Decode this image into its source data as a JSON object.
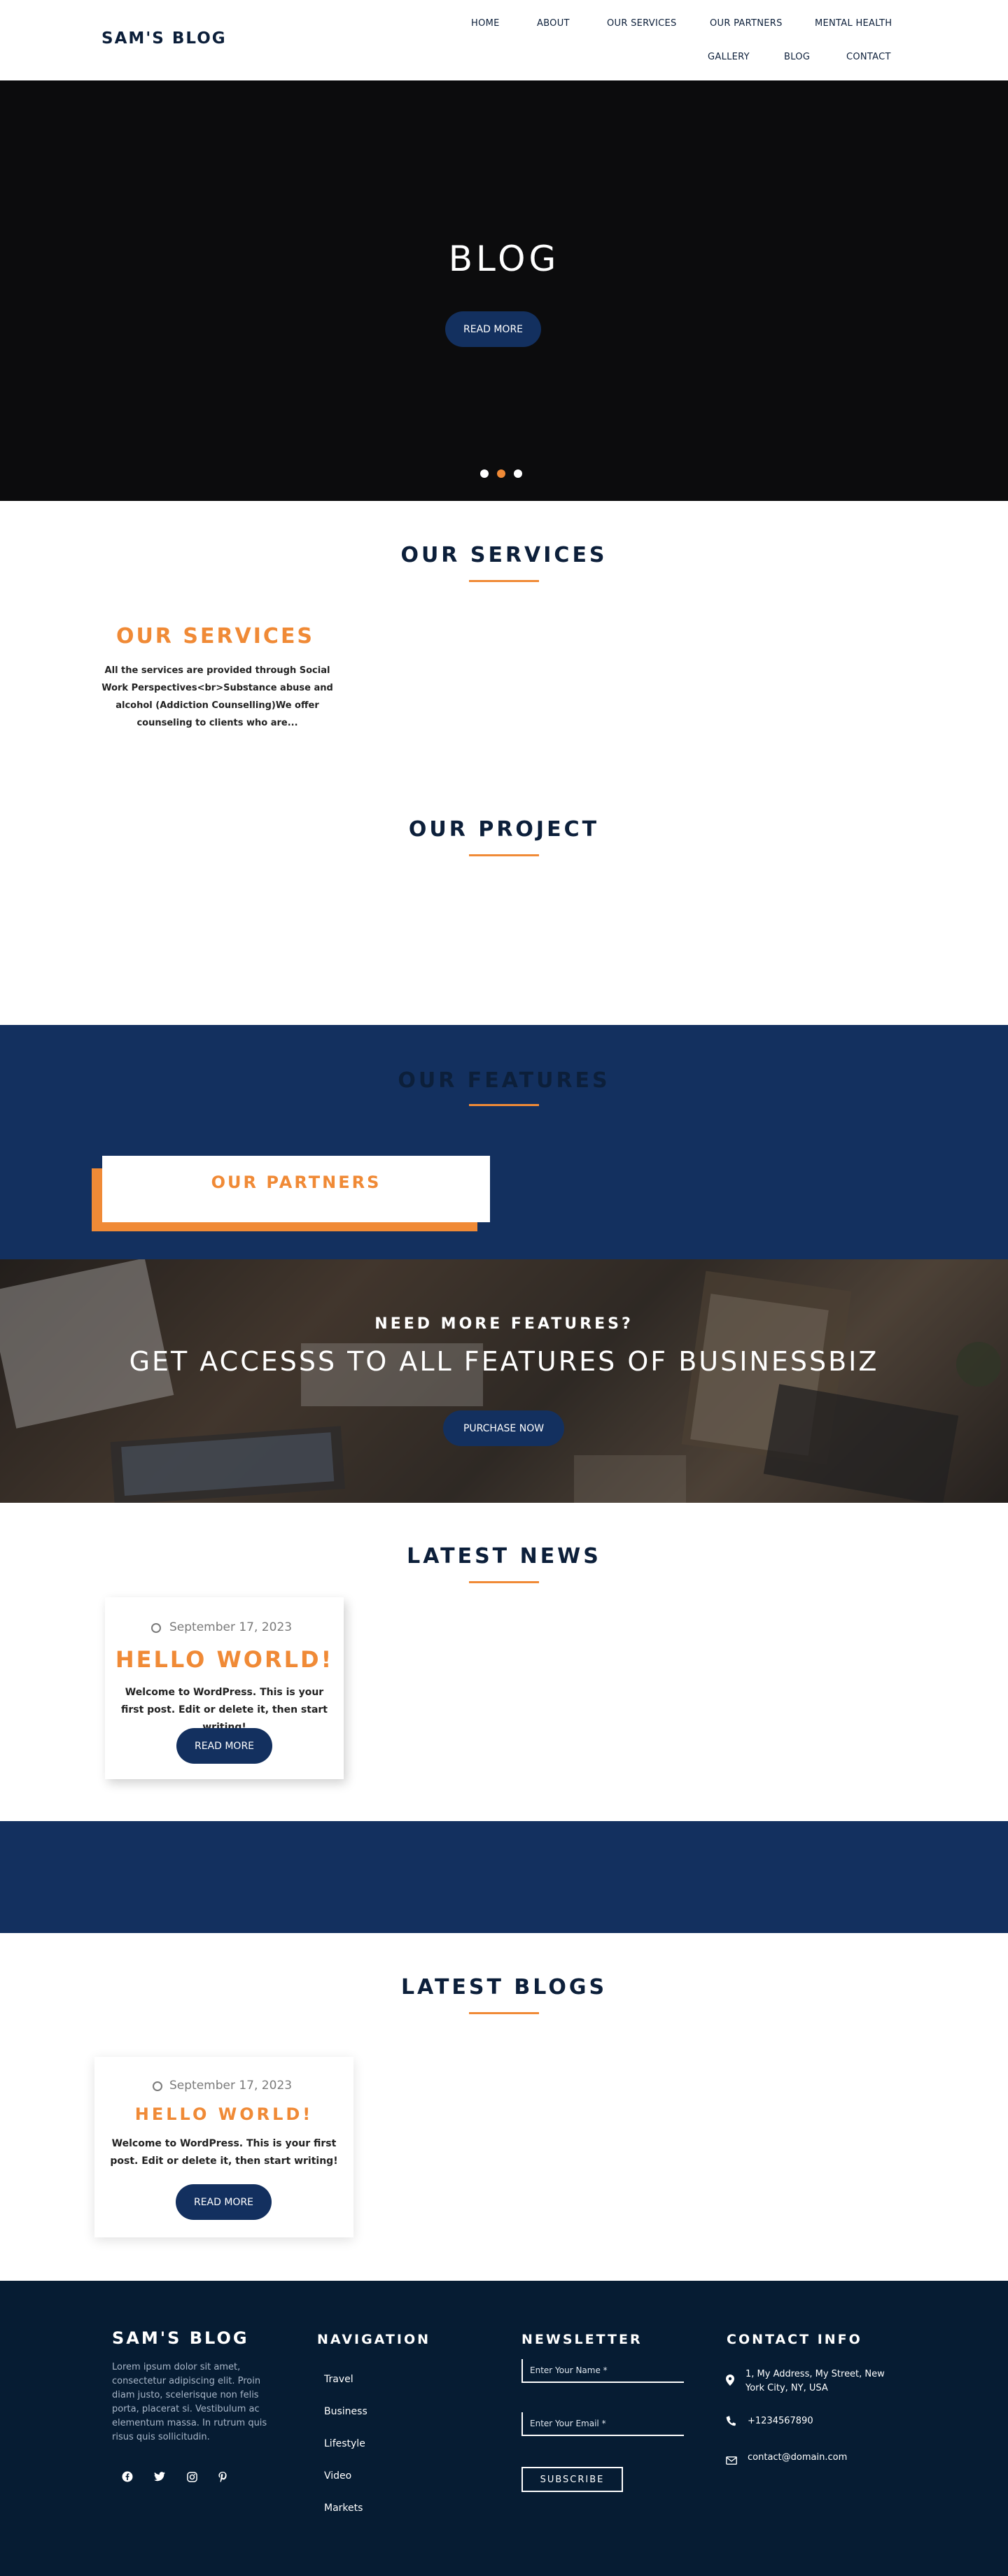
{
  "header": {
    "logo": "SAM'S BLOG",
    "nav": [
      "HOME",
      "ABOUT",
      "OUR SERVICES",
      "OUR PARTNERS",
      "MENTAL HEALTH",
      "GALLERY",
      "BLOG",
      "CONTACT"
    ]
  },
  "hero": {
    "title": "BLOG",
    "button": "READ MORE",
    "slides": 3,
    "active_slide": 2
  },
  "services": {
    "section_title": "OUR SERVICES",
    "card_title": "OUR SERVICES",
    "card_text": "All the services are provided through Social Work Perspectives<br>Substance abuse and alcohol (Addiction Counselling)We offer counseling to clients who are..."
  },
  "project": {
    "section_title": "OUR PROJECT"
  },
  "features": {
    "section_title": "OUR FEATURES",
    "partners_title": "OUR PARTNERS"
  },
  "cta": {
    "kicker": "NEED MORE FEATURES?",
    "headline": "GET ACCESSS TO ALL FEATURES OF BUSINESSBIZ",
    "button": "PURCHASE NOW"
  },
  "news": {
    "section_title": "LATEST NEWS",
    "date": "September 17, 2023",
    "post_title": "HELLO WORLD!",
    "excerpt": "Welcome to WordPress. This is your first post. Edit or delete it, then start writing!",
    "button": "READ MORE"
  },
  "blogs": {
    "section_title": "LATEST BLOGS",
    "date": "September 17, 2023",
    "post_title": "HELLO WORLD!",
    "excerpt": "Welcome to WordPress. This is your first post. Edit or delete it, then start writing!",
    "button": "READ MORE"
  },
  "footer": {
    "brand": "SAM'S BLOG",
    "about": "Lorem ipsum dolor sit amet, consectetur adipiscing elit. Proin diam justo, scelerisque non felis porta, placerat si. Vestibulum ac elementum massa. In rutrum quis risus quis sollicitudin.",
    "social_icons": [
      "facebook-icon",
      "twitter-icon",
      "instagram-icon",
      "pinterest-icon"
    ],
    "navigation_title": "NAVIGATION",
    "navigation": [
      "Travel",
      "Business",
      "Lifestyle",
      "Video",
      "Markets"
    ],
    "newsletter_title": "NEWSLETTER",
    "name_placeholder": "Enter Your Name *",
    "email_placeholder": "Enter Your Email *",
    "subscribe": "SUBSCRIBE",
    "contact_title": "CONTACT INFO",
    "address": "1, My Address, My Street, New York City, NY, USA",
    "phone": "+1234567890",
    "email": "contact@domain.com"
  },
  "colors": {
    "navy": "#13305f",
    "dark": "#061c33",
    "orange": "#f08a36",
    "hero_bg": "#0c0c0d"
  }
}
